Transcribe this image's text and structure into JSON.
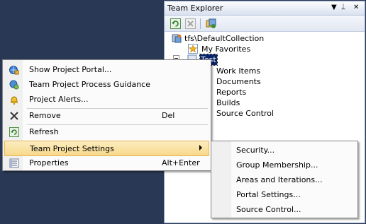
{
  "team_explorer": {
    "title": "Team Explorer",
    "title_buttons": [
      "▼",
      "ᛦ",
      "✕"
    ],
    "toolbar_icons": [
      "refresh-icon",
      "stop-icon",
      "add-project-icon"
    ],
    "tree": {
      "root": "tfs\\DefaultCollection",
      "favorites": "My Favorites",
      "project": "Test",
      "children": [
        "Work Items",
        "Documents",
        "Reports",
        "Builds",
        "Source Control"
      ]
    }
  },
  "context_menu": {
    "items": [
      {
        "label": "Show Project Portal...",
        "icon": "portal-icon",
        "shortcut": ""
      },
      {
        "label": "Team Project Process Guidance",
        "icon": "guidance-icon",
        "shortcut": ""
      },
      {
        "label": "Project Alerts...",
        "icon": "bell-icon",
        "shortcut": ""
      },
      {
        "label": "Remove",
        "icon": "remove-x-icon",
        "shortcut": "Del"
      },
      {
        "label": "Refresh",
        "icon": "refresh-icon",
        "shortcut": ""
      },
      {
        "label": "Team Project Settings",
        "icon": "",
        "shortcut": "",
        "submenu": true
      },
      {
        "label": "Properties",
        "icon": "properties-icon",
        "shortcut": "Alt+Enter"
      }
    ]
  },
  "submenu": {
    "items": [
      "Security...",
      "Group Membership...",
      "Areas and Iterations...",
      "Portal Settings...",
      "Source Control..."
    ]
  },
  "colors": {
    "desktop": "#293955",
    "highlight": "#f8d98b",
    "highlight_border": "#e5b456"
  }
}
